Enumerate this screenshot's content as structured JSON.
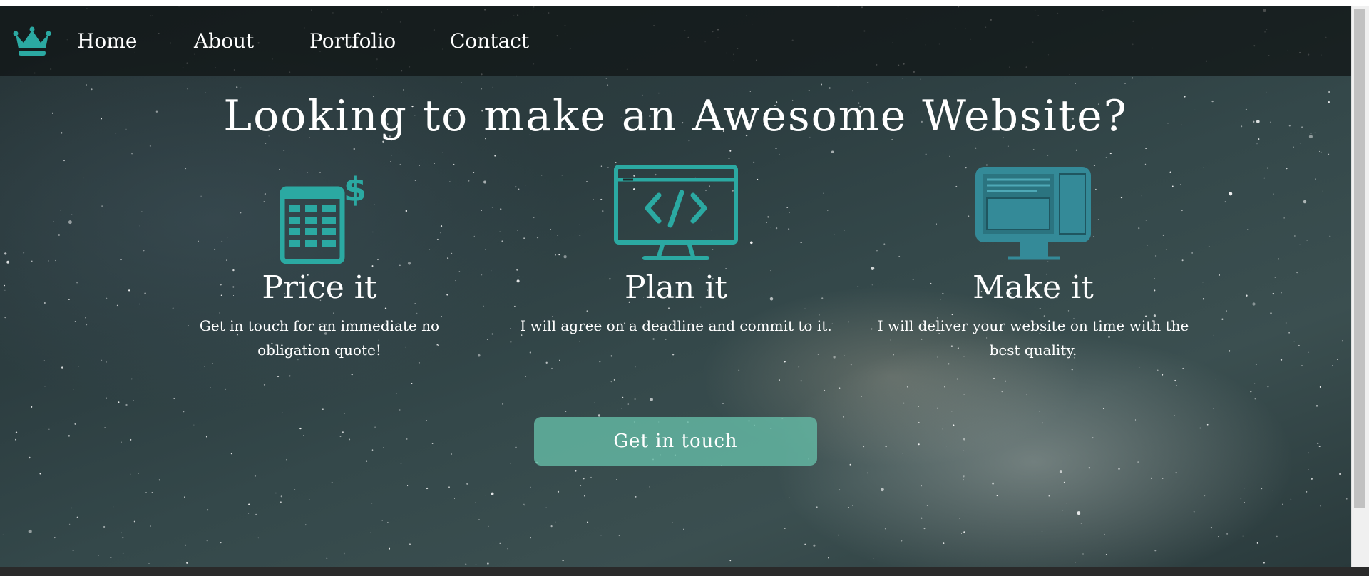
{
  "nav": {
    "logo_icon": "crown-icon",
    "links": [
      "Home",
      "About",
      "Portfolio",
      "Contact"
    ]
  },
  "hero": {
    "headline": "Looking to make an Awesome Website?",
    "features": [
      {
        "icon": "calculator-dollar-icon",
        "title": "Price it",
        "text": "Get in touch for an immediate no obligation quote!"
      },
      {
        "icon": "monitor-code-icon",
        "title": "Plan it",
        "text": "I will agree on a deadline and commit to it."
      },
      {
        "icon": "desktop-layout-icon",
        "title": "Make it",
        "text": "I will deliver your website on time with the best quality."
      }
    ],
    "cta_label": "Get in touch"
  },
  "colors": {
    "accent": "#2ba9a2",
    "cta_background": "#64b9a5",
    "navbar_background": "#0f1414"
  }
}
